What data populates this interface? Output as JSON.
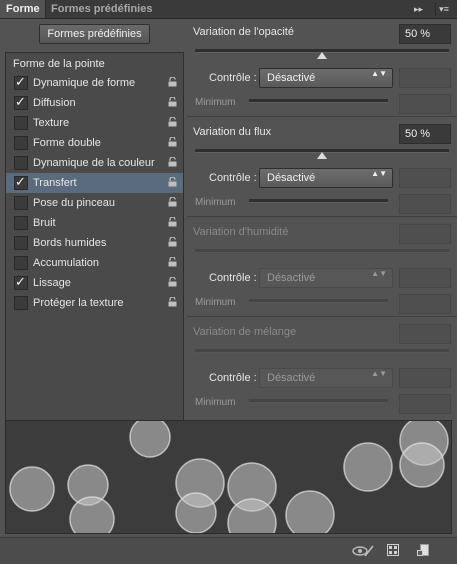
{
  "tabs": {
    "active": "Forme",
    "inactive": "Formes prédéfinies"
  },
  "tab_controls": {
    "collapse": "▸▸",
    "menu": "▾≡"
  },
  "presets_button": "Formes prédéfinies",
  "tip_header": "Forme de la pointe",
  "options": [
    {
      "label": "Dynamique de forme",
      "checked": true,
      "selected": false
    },
    {
      "label": "Diffusion",
      "checked": true,
      "selected": false
    },
    {
      "label": "Texture",
      "checked": false,
      "selected": false
    },
    {
      "label": "Forme double",
      "checked": false,
      "selected": false
    },
    {
      "label": "Dynamique de la couleur",
      "checked": false,
      "selected": false
    },
    {
      "label": "Transfert",
      "checked": true,
      "selected": true
    },
    {
      "label": "Pose du pinceau",
      "checked": false,
      "selected": false
    },
    {
      "label": "Bruit",
      "checked": false,
      "selected": false
    },
    {
      "label": "Bords humides",
      "checked": false,
      "selected": false
    },
    {
      "label": "Accumulation",
      "checked": false,
      "selected": false
    },
    {
      "label": "Lissage",
      "checked": true,
      "selected": false
    },
    {
      "label": "Protéger la texture",
      "checked": false,
      "selected": false
    }
  ],
  "check_glyph": "✓",
  "sections": [
    {
      "label": "Variation de l'opacité",
      "value": "50 %",
      "enabled": true,
      "control_label": "Contrôle :",
      "control_value": "Désactivé",
      "min_label": "Minimum"
    },
    {
      "label": "Variation du flux",
      "value": "50 %",
      "enabled": true,
      "control_label": "Contrôle :",
      "control_value": "Désactivé",
      "min_label": "Minimum"
    },
    {
      "label": "Variation d'humidité",
      "value": "",
      "enabled": false,
      "control_label": "Contrôle :",
      "control_value": "Désactivé",
      "min_label": "Minimum"
    },
    {
      "label": "Variation de mélange",
      "value": "",
      "enabled": false,
      "control_label": "Contrôle :",
      "control_value": "Désactivé",
      "min_label": "Minimum"
    }
  ],
  "select_arrows": "▲▼",
  "colors": {
    "selection": "#5a6b7e",
    "panel": "#535353",
    "preview_bg": "#3c3c3c"
  },
  "bottom_icons": [
    "brush-toggle-icon",
    "grid-icon",
    "new-preset-icon"
  ]
}
